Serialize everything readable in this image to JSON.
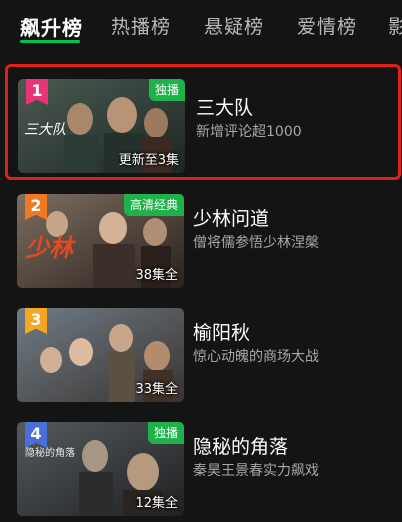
{
  "tabs": [
    {
      "label": "飙升榜",
      "active": true
    },
    {
      "label": "热播榜",
      "active": false
    },
    {
      "label": "悬疑榜",
      "active": false
    },
    {
      "label": "爱情榜",
      "active": false
    },
    {
      "label": "影",
      "active": false
    }
  ],
  "items": [
    {
      "rank": "1",
      "rank_color": "#e8357a",
      "badge": "独播",
      "episodes": "更新至3集",
      "poster_text": "三大队",
      "title": "三大队",
      "desc": "新增评论超1000"
    },
    {
      "rank": "2",
      "rank_color": "#f07a23",
      "badge": "高清经典",
      "episodes": "38集全",
      "poster_text": "少林",
      "title": "少林问道",
      "desc": "僧将儒参悟少林涅槃"
    },
    {
      "rank": "3",
      "rank_color": "#f5a623",
      "badge": "",
      "episodes": "33集全",
      "poster_text": "",
      "title": "榆阳秋",
      "desc": "惊心动魄的商场大战"
    },
    {
      "rank": "4",
      "rank_color": "#4a6fd8",
      "badge": "独播",
      "episodes": "12集全",
      "poster_text": "隐秘的角落",
      "title": "隐秘的角落",
      "desc": "秦昊王景春实力飙戏"
    }
  ],
  "colors": {
    "accent": "#00c250",
    "highlight_border": "#e0211b",
    "badge_green": "#1fb24a"
  }
}
